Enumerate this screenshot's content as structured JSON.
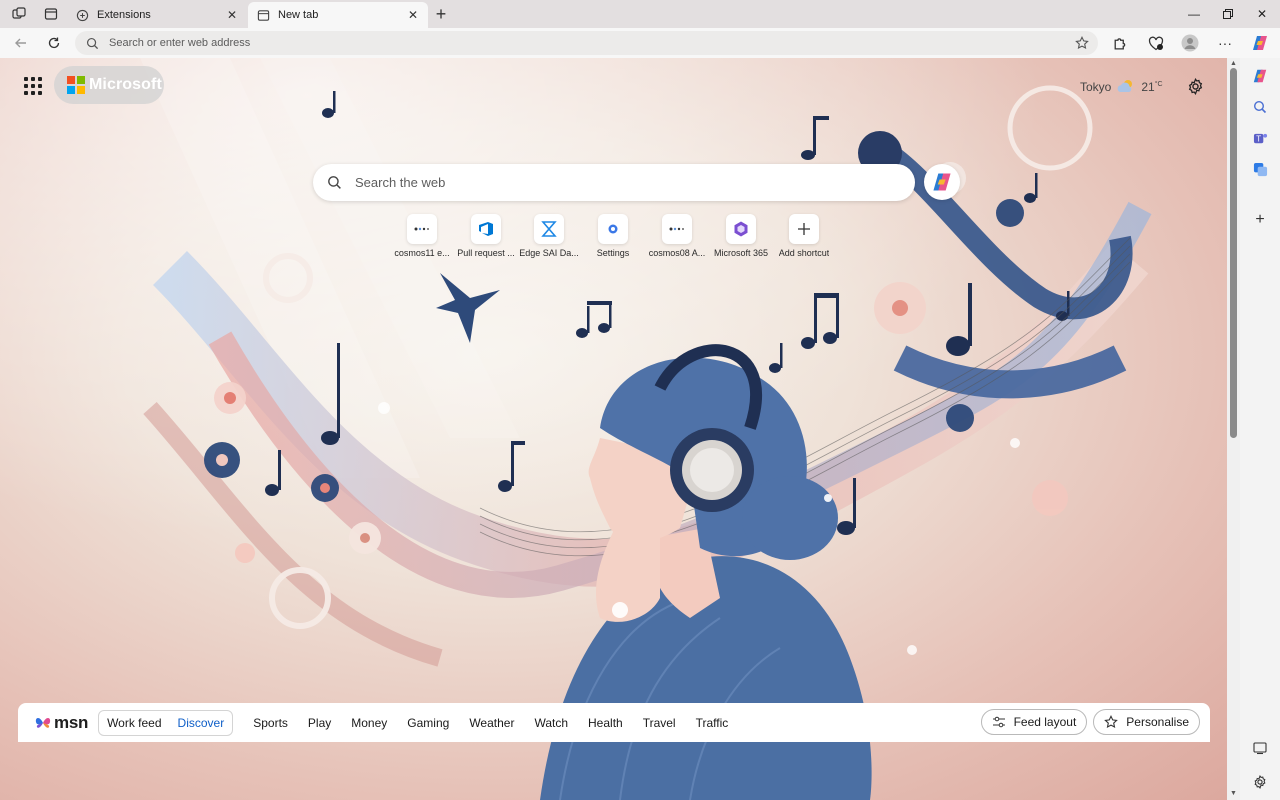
{
  "browser": {
    "tabs": [
      {
        "label": "Extensions",
        "active": false
      },
      {
        "label": "New tab",
        "active": true
      }
    ],
    "address_placeholder": "Search or enter web address"
  },
  "new_tab": {
    "brand": "Microsoft",
    "weather": {
      "city": "Tokyo",
      "temperature": "21",
      "unit": "°C"
    },
    "search_placeholder": "Search the web",
    "shortcuts": [
      {
        "label": "cosmos11 e...",
        "icon": "dots-logo-icon"
      },
      {
        "label": "Pull request ...",
        "icon": "azure-devops-icon"
      },
      {
        "label": "Edge SAI Da...",
        "icon": "hourglass-icon"
      },
      {
        "label": "Settings",
        "icon": "settings-dot-icon"
      },
      {
        "label": "cosmos08 A...",
        "icon": "dots-logo-icon"
      },
      {
        "label": "Microsoft 365",
        "icon": "m365-icon"
      },
      {
        "label": "Add shortcut",
        "icon": "plus-icon"
      }
    ]
  },
  "msn": {
    "logo": "msn",
    "feed_tabs": [
      "Work feed",
      "Discover"
    ],
    "selected_feed": "Discover",
    "nav": [
      "Sports",
      "Play",
      "Money",
      "Gaming",
      "Weather",
      "Watch",
      "Health",
      "Travel",
      "Traffic"
    ],
    "feed_layout_label": "Feed layout",
    "personalise_label": "Personalise"
  },
  "colors": {
    "ms_red": "#f25022",
    "ms_green": "#7fba00",
    "ms_blue": "#00a4ef",
    "ms_yellow": "#ffb900",
    "accent": "#0f5fc8"
  }
}
